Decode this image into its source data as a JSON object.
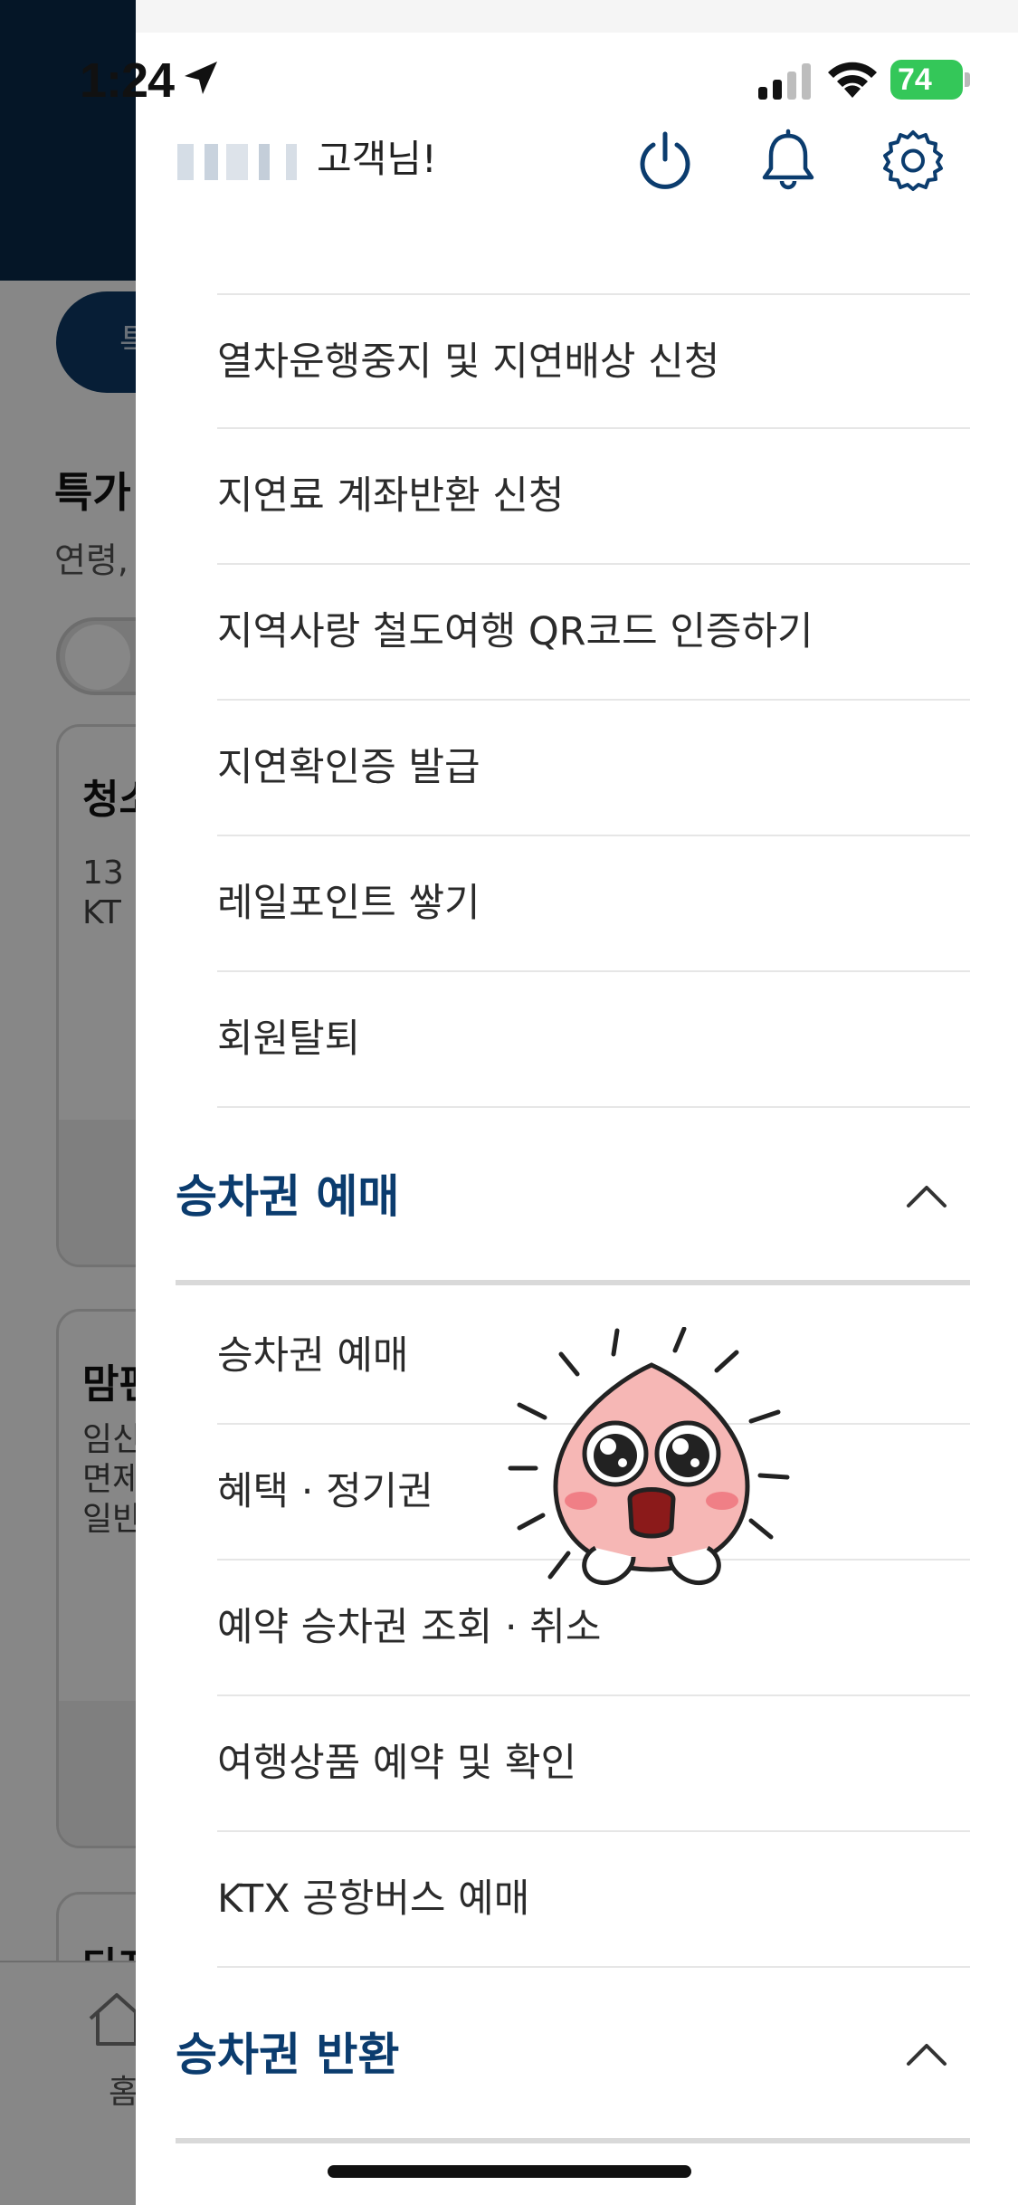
{
  "status_bar": {
    "time": "1:24",
    "battery": "74"
  },
  "background": {
    "pill_text": "특",
    "section_title": "특가",
    "section_sub": "연령,",
    "cards": [
      {
        "title": "청소",
        "text": "13\nKT"
      },
      {
        "title": "맘편",
        "text": "임신\n면제\n일반"
      },
      {
        "title": "다자",
        "text": ""
      }
    ],
    "tab_home": "홈"
  },
  "drawer": {
    "greeting": "고객님!",
    "items_top": [
      "열차운행중지 및 지연배상 신청",
      "지연료 계좌반환 신청",
      "지역사랑 철도여행 QR코드 인증하기",
      "지연확인증 발급",
      "레일포인트 쌓기",
      "회원탈퇴"
    ],
    "section_reservation": {
      "title": "승차권 예매",
      "items": [
        "승차권 예매",
        "혜택 · 정기권",
        "예약 승차권 조회 · 취소",
        "여행상품 예약 및 확인",
        "KTX 공항버스 예매"
      ]
    },
    "section_refund": {
      "title": "승차권 반환"
    }
  },
  "colors": {
    "accent": "#0b3c6e",
    "header_bg": "#0a2a4a",
    "battery": "#34c759"
  }
}
